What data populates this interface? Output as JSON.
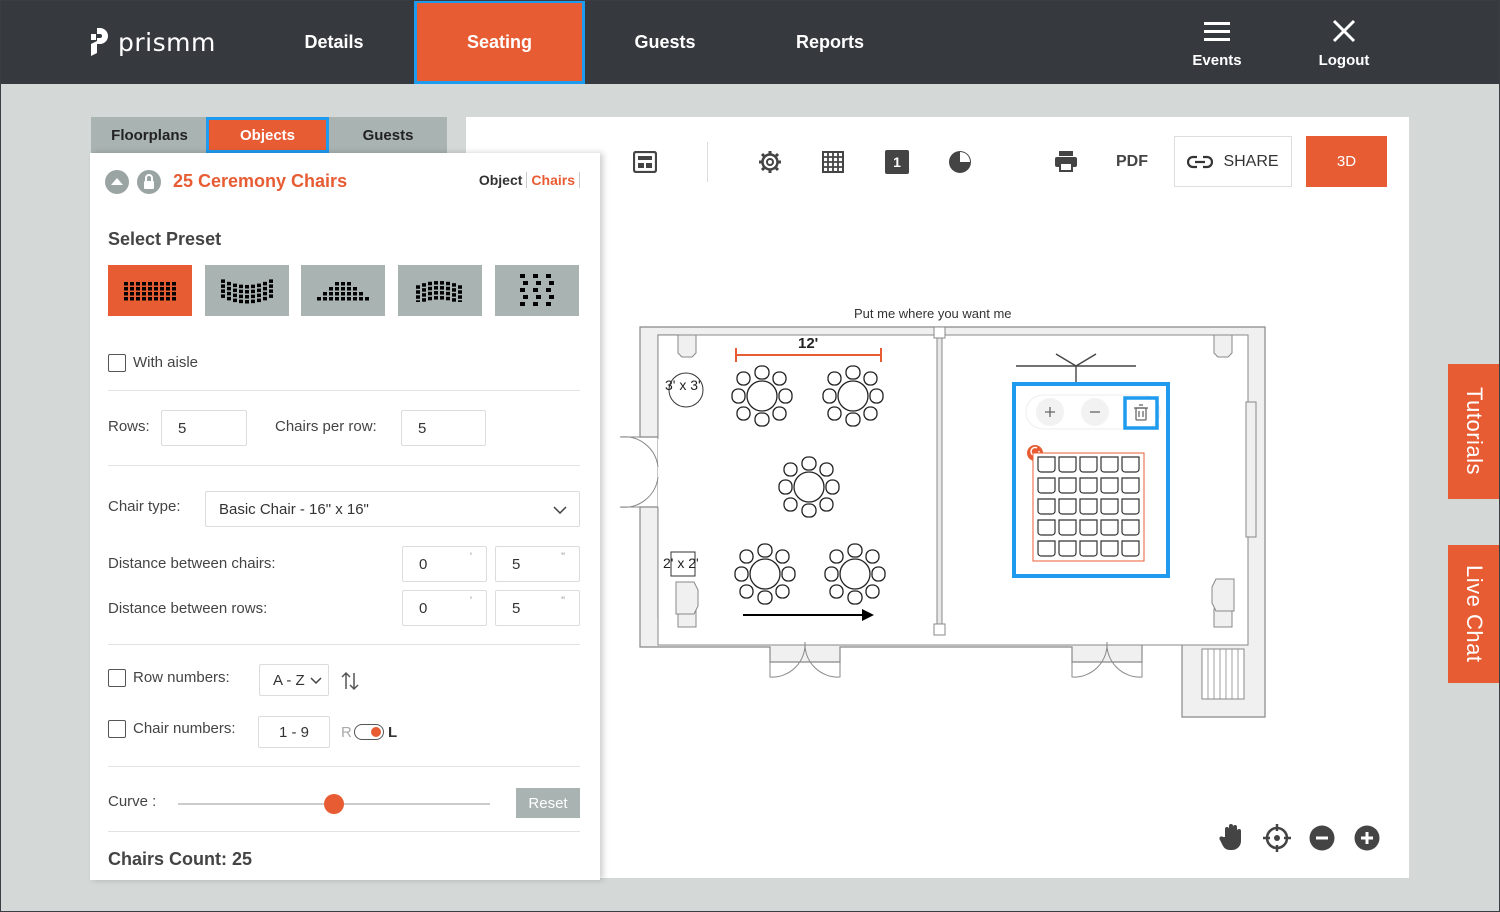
{
  "app": {
    "logo_text": "prismm",
    "nav": [
      {
        "label": "Details",
        "active": false
      },
      {
        "label": "Seating",
        "active": true
      },
      {
        "label": "Guests",
        "active": false
      },
      {
        "label": "Reports",
        "active": false
      }
    ],
    "actions": {
      "events": "Events",
      "logout": "Logout"
    }
  },
  "panel_tabs": [
    {
      "label": "Floorplans",
      "active": false
    },
    {
      "label": "Objects",
      "active": true
    },
    {
      "label": "Guests",
      "active": false
    }
  ],
  "object_panel": {
    "title": "25 Ceremony Chairs",
    "mode_object": "Object",
    "mode_chairs": "Chairs",
    "select_preset_label": "Select Preset",
    "presets": [
      "straight-rows",
      "curved-rows",
      "theater",
      "arc",
      "staggered"
    ],
    "active_preset": 0,
    "with_aisle_label": "With aisle",
    "rows_label": "Rows:",
    "rows_value": "5",
    "chairs_per_row_label": "Chairs per row:",
    "chairs_per_row_value": "5",
    "chair_type_label": "Chair type:",
    "chair_type_value": "Basic Chair - 16\" x 16\"",
    "distance_chairs_label": "Distance between chairs:",
    "distance_chairs_ft": "0",
    "distance_chairs_in": "5",
    "distance_rows_label": "Distance between rows:",
    "distance_rows_ft": "0",
    "distance_rows_in": "5",
    "feet_mark": "'",
    "inch_mark": "\"",
    "row_numbers_label": "Row numbers:",
    "row_numbers_value": "A - Z",
    "chair_numbers_label": "Chair numbers:",
    "chair_numbers_value": "1 - 9",
    "toggle_r": "R",
    "toggle_l": "L",
    "curve_label": "Curve :",
    "curve_value": 0.5,
    "reset_label": "Reset",
    "chairs_count_label": "Chairs Count: 25"
  },
  "toolbar": {
    "pdf_label": "PDF",
    "share_label": "SHARE",
    "btn_3d_label": "3D",
    "layer_number": "1"
  },
  "floorplan": {
    "caption": "Put me where you want me",
    "dimension_label": "12'",
    "table_label_round": "3' x 3'",
    "table_label_square": "2' x 2'"
  },
  "side_tabs": {
    "tutorials": "Tutorials",
    "live_chat": "Live Chat"
  },
  "colors": {
    "accent": "#e85c33",
    "dark": "#363a3e",
    "highlight": "#1e9bef",
    "grey_button": "#a9b3b1"
  }
}
